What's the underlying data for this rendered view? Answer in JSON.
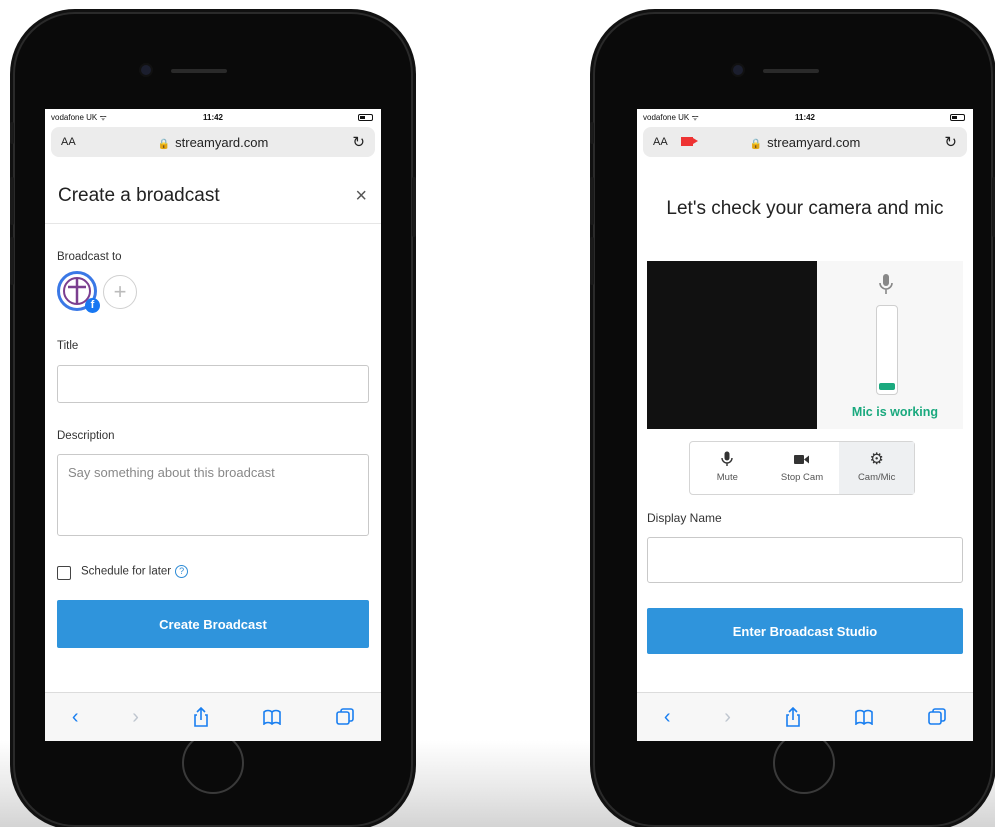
{
  "phones": [
    {
      "status": {
        "carrier": "vodafone UK",
        "time": "11:42"
      },
      "urlbar": {
        "aa": "AA",
        "url": "streamyard.com"
      },
      "header": {
        "title": "Create a broadcast",
        "close": "×"
      },
      "form": {
        "broadcast_to_label": "Broadcast to",
        "title_label": "Title",
        "title_value": "",
        "description_label": "Description",
        "description_placeholder": "Say something about this broadcast",
        "schedule_label": "Schedule for later",
        "submit_label": "Create Broadcast"
      }
    },
    {
      "status": {
        "carrier": "vodafone UK",
        "time": "11:42"
      },
      "urlbar": {
        "aa": "AA",
        "url": "streamyard.com"
      },
      "heading": "Let's check your camera and mic",
      "mic_status": "Mic is working",
      "mic_level_fraction": 0.08,
      "controls": [
        {
          "label": "Mute",
          "icon": "microphone-icon"
        },
        {
          "label": "Stop Cam",
          "icon": "video-camera-icon"
        },
        {
          "label": "Cam/Mic",
          "icon": "gear-icon"
        }
      ],
      "display_name_label": "Display Name",
      "display_name_value": "",
      "submit_label": "Enter Broadcast Studio"
    }
  ],
  "colors": {
    "primary": "#2f94dc",
    "success": "#1aa97e",
    "ios_blue": "#1a7ff0"
  }
}
